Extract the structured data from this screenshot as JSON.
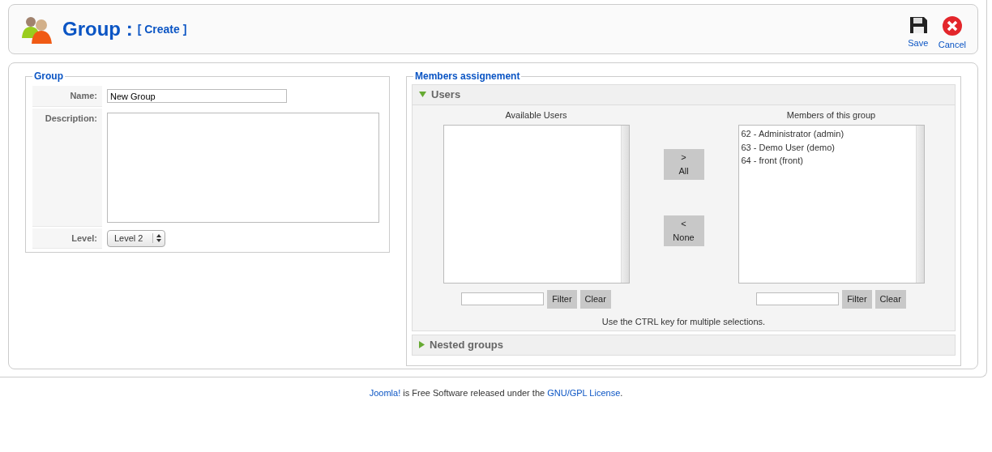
{
  "toolbar": {
    "title": "Group :",
    "subtitle": "[ Create ]",
    "buttons": [
      {
        "kind": "save",
        "label": "Save"
      },
      {
        "kind": "cancel",
        "label": "Cancel"
      }
    ]
  },
  "group_fieldset": {
    "legend": "Group",
    "name": {
      "label": "Name:",
      "value": "New Group"
    },
    "description": {
      "label": "Description:"
    },
    "level": {
      "label": "Level:",
      "value": "Level 2"
    }
  },
  "members_fieldset": {
    "legend": "Members assignement",
    "panels": [
      {
        "title": "Users",
        "expanded": true,
        "available": {
          "heading": "Available Users",
          "filter": "Filter",
          "clear": "Clear"
        },
        "members": {
          "heading": "Members of this group",
          "items": [
            "62 - Administrator (admin)",
            "63 - Demo User (demo)",
            "64 - front (front)"
          ],
          "filter": "Filter",
          "clear": "Clear"
        },
        "add_all": {
          "symbol": ">",
          "label": "All"
        },
        "remove_all": {
          "symbol": "<",
          "label": "None"
        },
        "hint": "Use the CTRL key for multiple selections."
      },
      {
        "title": "Nested groups",
        "expanded": false
      }
    ]
  },
  "footer": [
    {
      "kind": "link",
      "text": "Joomla!"
    },
    {
      "kind": "text",
      "text": " is Free Software released under the "
    },
    {
      "kind": "link",
      "text": "GNU/GPL License"
    },
    {
      "kind": "text",
      "text": "."
    }
  ]
}
